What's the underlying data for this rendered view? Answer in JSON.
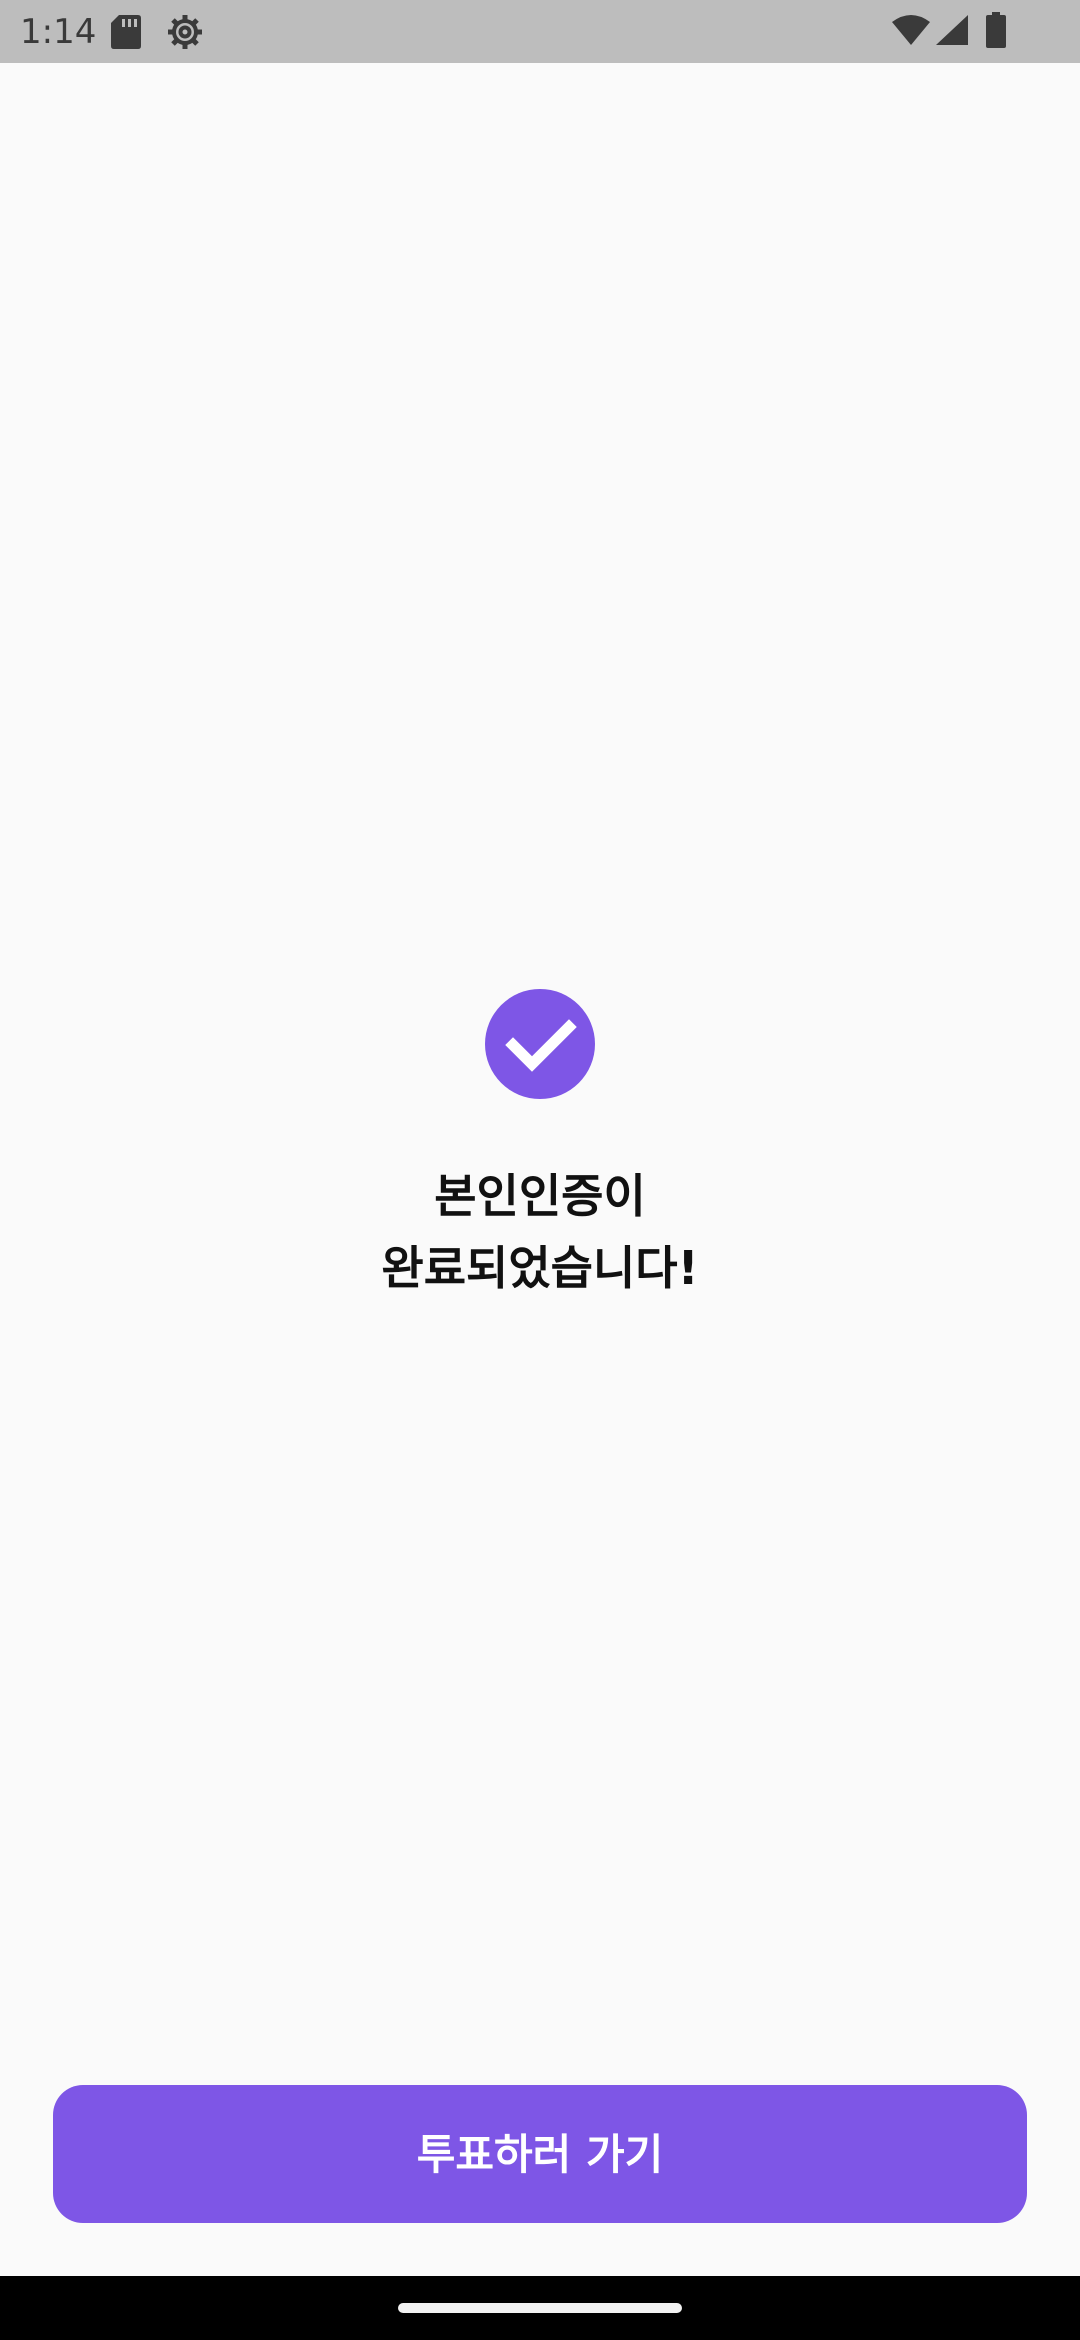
{
  "status_bar": {
    "time": "1:14",
    "icons": [
      "sd-card-icon",
      "gear-icon",
      "wifi-icon",
      "cell-signal-icon",
      "battery-icon"
    ]
  },
  "main": {
    "status_icon": "check-circle-icon",
    "message_line1": "본인인증이",
    "message_line2": "완료되었습니다!"
  },
  "footer": {
    "button_label": "투표하러 가기"
  },
  "colors": {
    "accent": "#7e56e6",
    "background": "#fafafa",
    "status_bar": "#bdbdbd",
    "text": "#111111"
  }
}
